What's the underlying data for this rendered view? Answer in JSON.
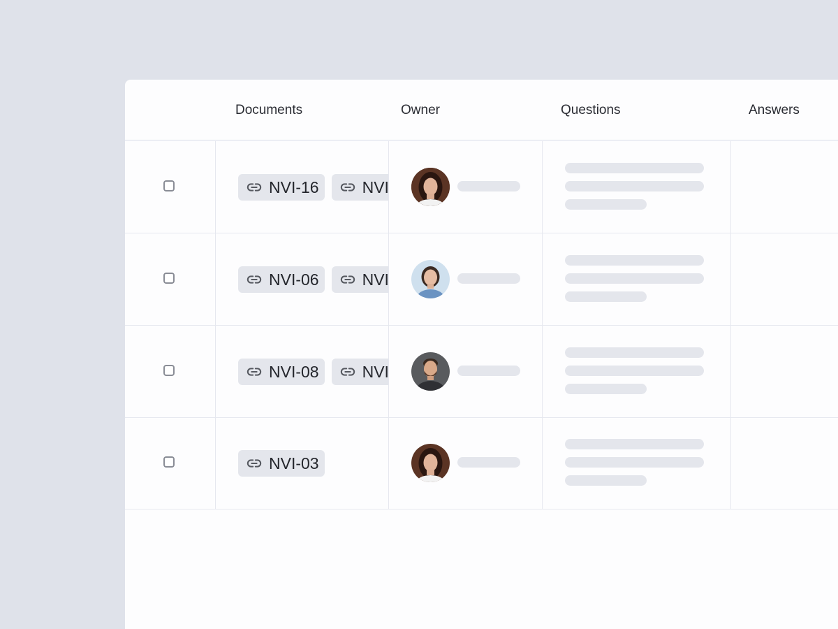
{
  "table": {
    "columns": [
      "Documents",
      "Owner",
      "Questions",
      "Answers"
    ],
    "rows": [
      {
        "docs": [
          "NVI-16",
          "NVI"
        ],
        "owner_avatar": "woman-dark-hair-avatar"
      },
      {
        "docs": [
          "NVI-06",
          "NVI"
        ],
        "owner_avatar": "woman-blue-shirt-avatar"
      },
      {
        "docs": [
          "NVI-08",
          "NVI"
        ],
        "owner_avatar": "man-beard-avatar"
      },
      {
        "docs": [
          "NVI-03"
        ],
        "owner_avatar": "woman-dark-hair-avatar"
      }
    ]
  },
  "icons": {
    "doc_link": "link-icon"
  },
  "colors": {
    "page_bg": "#dfe2ea",
    "panel_bg": "#fdfdfe",
    "chip_bg": "#e4e6ec",
    "skeleton": "#e4e6ec"
  }
}
